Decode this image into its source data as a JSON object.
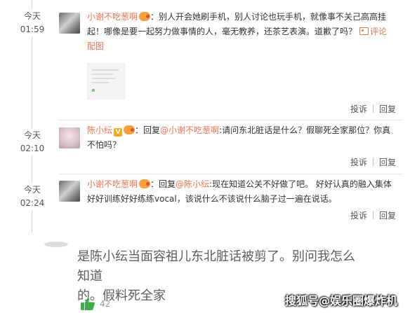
{
  "comments": [
    {
      "time_day": "今天",
      "time_clock": "01:59",
      "username": "小谢不吃葱啊",
      "text_lines": [
        "：别人开会她刷手机，别人讨论也玩手机，就像事不关己高高挂",
        "起！哪像是要一起努力做事情的人，毫无教养，还茶艺表演。道歉了吗？"
      ],
      "comment_pic_link": "评论",
      "comment_pic_link_line2": "配图",
      "actions": {
        "report": "投诉",
        "reply": "回复"
      }
    },
    {
      "time_day": "今天",
      "time_clock": "02:10",
      "username": "陈小纭",
      "verified_badge": "V",
      "reply_prefix": "：回复",
      "reply_target": "@小谢不吃葱啊",
      "text_line1": ":请问东北脏话是什么？假聊死全家那位？你真",
      "text_line2": "不怕吗？",
      "actions": {
        "report": "投诉",
        "reply": "回复"
      }
    },
    {
      "time_day": "今天",
      "time_clock": "02:24",
      "username": "小谢不吃葱啊",
      "reply_prefix": "：回复",
      "reply_target": "@陈小纭",
      "text_line1": ":现在知道公关不好做了吧。 好好认真的融入集体",
      "text_line2": "好好训练好好练练vocal，该说什么不该说什么脑子过一遍在说话。",
      "actions": {
        "report": "投诉",
        "reply": "回复"
      }
    }
  ],
  "lower_comment": {
    "text_line1": "是陈小纭当面容祖儿东北脏话被剪了。别问我怎么知道",
    "text_line2": "的。假料死全家",
    "likes": "42"
  },
  "watermark": "搜狐号@娱乐圈爆炸机",
  "colors": {
    "accent": "#eb7350",
    "like_green": "#3fae49"
  }
}
